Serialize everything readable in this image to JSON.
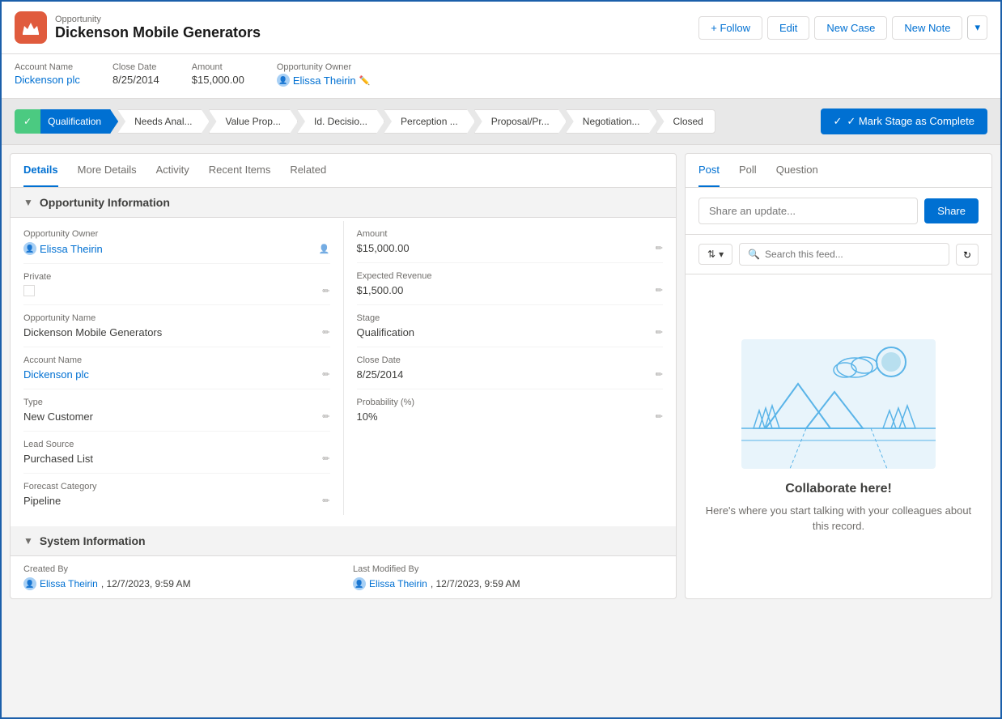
{
  "app": {
    "object_type": "Opportunity",
    "record_name": "Dickenson Mobile Generators"
  },
  "header": {
    "follow_label": "+ Follow",
    "edit_label": "Edit",
    "new_case_label": "New Case",
    "new_note_label": "New Note"
  },
  "meta": {
    "account_name_label": "Account Name",
    "account_name_value": "Dickenson plc",
    "close_date_label": "Close Date",
    "close_date_value": "8/25/2014",
    "amount_label": "Amount",
    "amount_value": "$15,000.00",
    "opportunity_owner_label": "Opportunity Owner",
    "opportunity_owner_value": "Elissa Theirin"
  },
  "stages": {
    "mark_complete_label": "✓ Mark Stage as Complete",
    "items": [
      {
        "label": "✓",
        "state": "completed"
      },
      {
        "label": "Qualification",
        "state": "active"
      },
      {
        "label": "Needs Anal...",
        "state": ""
      },
      {
        "label": "Value Prop...",
        "state": ""
      },
      {
        "label": "Id. Decisio...",
        "state": ""
      },
      {
        "label": "Perception ...",
        "state": ""
      },
      {
        "label": "Proposal/Pr...",
        "state": ""
      },
      {
        "label": "Negotiation...",
        "state": ""
      },
      {
        "label": "Closed",
        "state": ""
      }
    ]
  },
  "tabs": {
    "items": [
      {
        "label": "Details",
        "active": true
      },
      {
        "label": "More Details",
        "active": false
      },
      {
        "label": "Activity",
        "active": false
      },
      {
        "label": "Recent Items",
        "active": false
      },
      {
        "label": "Related",
        "active": false
      }
    ]
  },
  "opportunity_info": {
    "section_title": "Opportunity Information",
    "fields_left": [
      {
        "label": "Opportunity Owner",
        "value": "Elissa Theirin",
        "type": "link"
      },
      {
        "label": "Private",
        "value": "",
        "type": "checkbox"
      },
      {
        "label": "Opportunity Name",
        "value": "Dickenson Mobile Generators",
        "type": "text"
      },
      {
        "label": "Account Name",
        "value": "Dickenson plc",
        "type": "link"
      },
      {
        "label": "Type",
        "value": "New Customer",
        "type": "text"
      },
      {
        "label": "Lead Source",
        "value": "Purchased List",
        "type": "text"
      },
      {
        "label": "Forecast Category",
        "value": "Pipeline",
        "type": "text"
      }
    ],
    "fields_right": [
      {
        "label": "Amount",
        "value": "$15,000.00",
        "type": "text"
      },
      {
        "label": "Expected Revenue",
        "value": "$1,500.00",
        "type": "text"
      },
      {
        "label": "Stage",
        "value": "Qualification",
        "type": "text"
      },
      {
        "label": "Close Date",
        "value": "8/25/2014",
        "type": "text"
      },
      {
        "label": "Probability (%)",
        "value": "10%",
        "type": "text"
      }
    ]
  },
  "system_info": {
    "section_title": "System Information",
    "created_by_label": "Created By",
    "created_by_value": "Elissa Theirin",
    "created_date": ", 12/7/2023, 9:59 AM",
    "modified_by_label": "Last Modified By",
    "modified_by_value": "Elissa Theirin",
    "modified_date": ", 12/7/2023, 9:59 AM"
  },
  "right_panel": {
    "tabs": [
      {
        "label": "Post",
        "active": true
      },
      {
        "label": "Poll",
        "active": false
      },
      {
        "label": "Question",
        "active": false
      }
    ],
    "share_placeholder": "Share an update...",
    "share_btn": "Share",
    "search_placeholder": "Search this feed...",
    "collaborate_title": "Collaborate here!",
    "collaborate_text": "Here's where you start talking with your colleagues about this record."
  }
}
